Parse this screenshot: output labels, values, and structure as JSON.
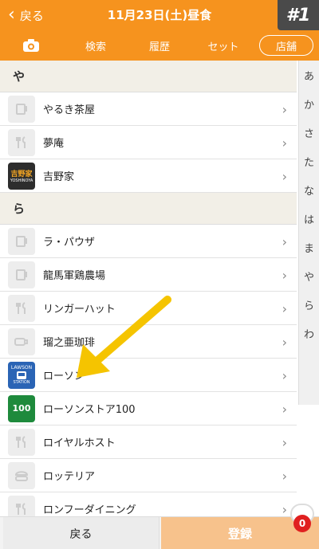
{
  "header": {
    "back_label": "戻る",
    "title": "11月23日(土)昼食",
    "badge": "#1"
  },
  "tabs": [
    {
      "label": "",
      "icon": "camera-icon"
    },
    {
      "label": "検索"
    },
    {
      "label": "履歴"
    },
    {
      "label": "セット"
    },
    {
      "label": "店舗"
    }
  ],
  "sections": [
    {
      "heading": "や",
      "items": [
        {
          "label": "やるき茶屋",
          "icon": "cup-icon"
        },
        {
          "label": "夢庵",
          "icon": "cutlery-icon"
        },
        {
          "label": "吉野家",
          "icon": "yoshinoya-logo"
        }
      ]
    },
    {
      "heading": "ら",
      "items": [
        {
          "label": "ラ・パウザ",
          "icon": "cup-icon"
        },
        {
          "label": "龍馬軍鶏農場",
          "icon": "cup-icon"
        },
        {
          "label": "リンガーハット",
          "icon": "cutlery-icon"
        },
        {
          "label": "瑠之亜珈琲",
          "icon": "coffee-icon"
        },
        {
          "label": "ローソン",
          "icon": "lawson-logo"
        },
        {
          "label": "ローソンストア100",
          "icon": "lawson100-logo"
        },
        {
          "label": "ロイヤルホスト",
          "icon": "cutlery-icon"
        },
        {
          "label": "ロッテリア",
          "icon": "burger-icon"
        },
        {
          "label": "ロンフーダイニング",
          "icon": "cutlery-icon"
        }
      ]
    }
  ],
  "index": [
    "あ",
    "か",
    "さ",
    "た",
    "な",
    "は",
    "ま",
    "や",
    "ら",
    "わ"
  ],
  "logos": {
    "yoshinoya_top": "吉野家",
    "yoshinoya_bottom": "YOSHINOYA",
    "lawson_top": "LAWSON",
    "lawson_bottom": "STATION",
    "lawson100": "100"
  },
  "footer": {
    "back_label": "戻る",
    "register_label": "登録",
    "cart_count": "0"
  },
  "colors": {
    "accent": "#f6931e",
    "register": "#f7c28c",
    "arrow": "#f5c400"
  }
}
